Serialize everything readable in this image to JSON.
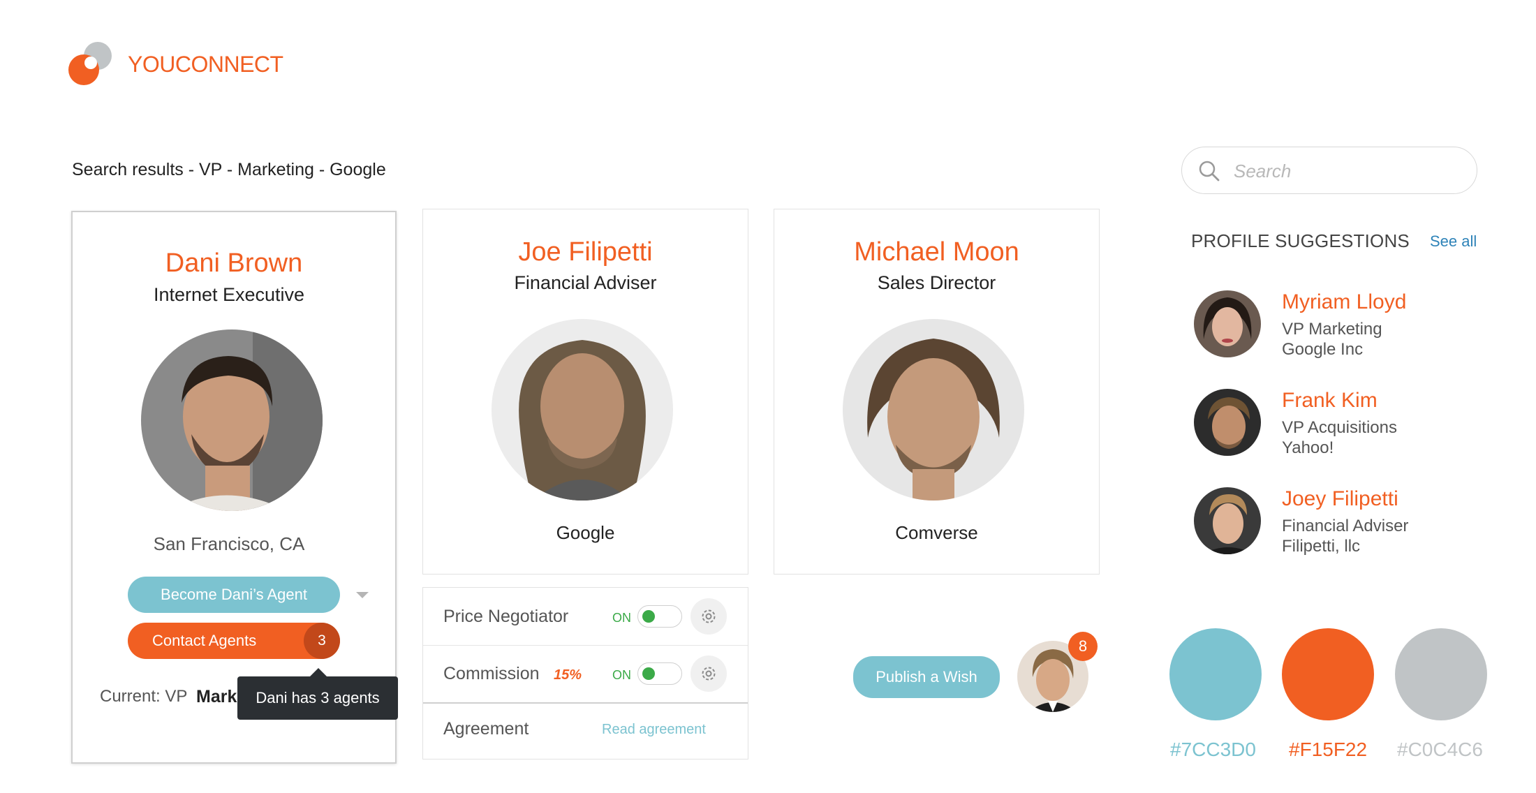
{
  "app": {
    "logo_text": "YOUCONNECT"
  },
  "breadcrumb": "Search results - VP - Marketing - Google",
  "search": {
    "placeholder": "Search",
    "value": ""
  },
  "cards": [
    {
      "name": "Dani Brown",
      "title": "Internet Executive",
      "location": "San Francisco, CA",
      "become_agent_label": "Become Dani’s Agent",
      "contact_agents_label": "Contact Agents",
      "agent_count": "3",
      "current_label": "Current: VP",
      "current_value": "Marke",
      "tooltip": "Dani has 3 agents"
    },
    {
      "name": "Joe Filipetti",
      "title": "Financial Adviser",
      "company": "Google"
    },
    {
      "name": "Michael Moon",
      "title": "Sales Director",
      "company": "Comverse"
    }
  ],
  "settings": {
    "rows": [
      {
        "label": "Price Negotiator",
        "toggle_label": "ON",
        "toggle_on": true
      },
      {
        "label": "Commission",
        "badge": "15%",
        "toggle_label": "ON",
        "toggle_on": true
      },
      {
        "label": "Agreement",
        "link": "Read agreement"
      }
    ]
  },
  "publish": {
    "label": "Publish a Wish",
    "notification_count": "8"
  },
  "suggestions": {
    "title": "PROFILE SUGGESTIONS",
    "see_all": "See all",
    "items": [
      {
        "name": "Myriam Lloyd",
        "line1": "VP Marketing",
        "line2": "Google Inc"
      },
      {
        "name": "Frank Kim",
        "line1": "VP Acquisitions",
        "line2": "Yahoo!"
      },
      {
        "name": "Joey Filipetti",
        "line1": "Financial Adviser",
        "line2": "Filipetti, llc"
      }
    ]
  },
  "palette": [
    {
      "label": "#7CC3D0",
      "color": "#7CC3D0"
    },
    {
      "label": "#F15F22",
      "color": "#F15F22"
    },
    {
      "label": "#C0C4C6",
      "color": "#C0C4C6"
    }
  ],
  "colors": {
    "accent": "#F15F22",
    "secondary": "#7CC3D0",
    "neutral": "#C0C4C6",
    "link": "#2E83B8",
    "toggle_on": "#3BAA48"
  },
  "icons": [
    "logo-mark",
    "search-icon",
    "chevron-down-icon",
    "gear-icon"
  ]
}
